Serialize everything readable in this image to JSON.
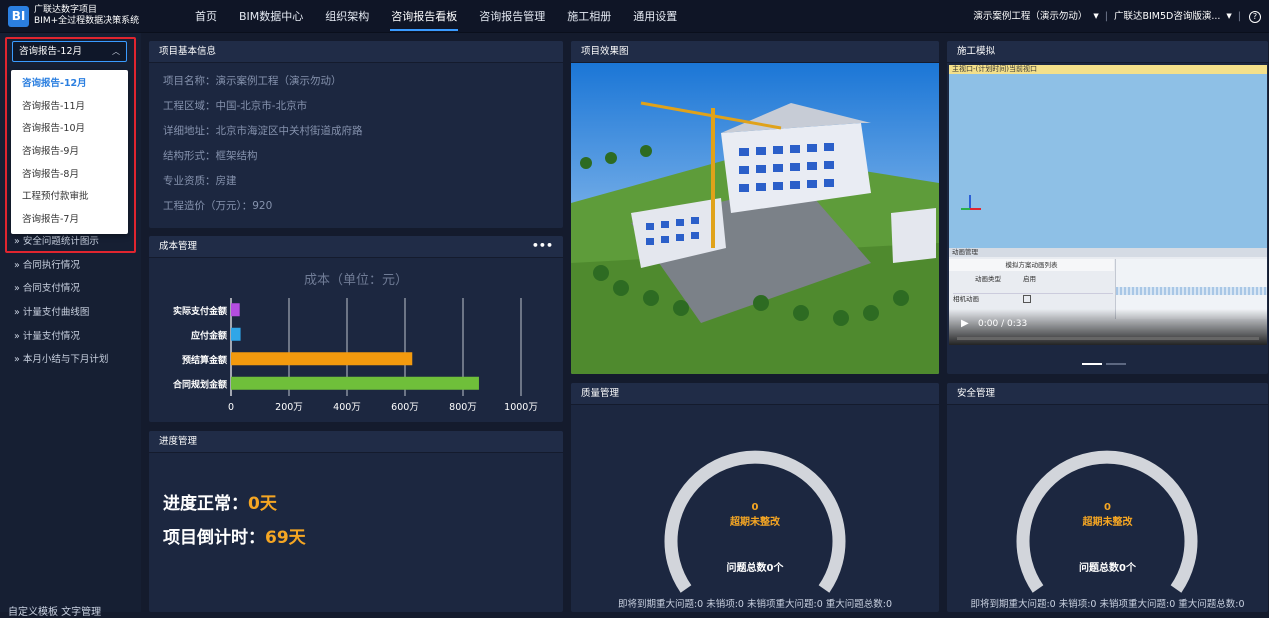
{
  "app": {
    "logo_text": "BI",
    "brand_line1": "广联达数字项目",
    "brand_line2": "BIM+全过程数据决策系统"
  },
  "nav": [
    {
      "label": "首页"
    },
    {
      "label": "BIM数据中心"
    },
    {
      "label": "组织架构"
    },
    {
      "label": "咨询报告看板",
      "active": true
    },
    {
      "label": "咨询报告管理"
    },
    {
      "label": "施工相册"
    },
    {
      "label": "通用设置"
    }
  ],
  "topright": {
    "project": "演示案例工程（演示勿动）",
    "company": "广联达BIM5D咨询版演...",
    "sep": "|",
    "help": "?"
  },
  "sidebar": {
    "select_value": "咨询报告-12月",
    "dropdown": [
      "咨询报告-12月",
      "咨询报告-11月",
      "咨询报告-10月",
      "咨询报告-9月",
      "咨询报告-8月",
      "工程预付款审批",
      "咨询报告-7月"
    ],
    "items": [
      "» 安全问题统计图示",
      "» 合同执行情况",
      "» 合同支付情况",
      "» 计量支付曲线图",
      "» 计量支付情况",
      "» 本月小结与下月计划"
    ],
    "bottom": "自定义模板      文字管理"
  },
  "panels": {
    "info": {
      "title": "项目基本信息",
      "rows": [
        {
          "label": "项目名称：",
          "value": "演示案例工程（演示勿动）"
        },
        {
          "label": "工程区域：",
          "value": "中国-北京市-北京市"
        },
        {
          "label": "详细地址：",
          "value": "北京市海淀区中关村街道成府路"
        },
        {
          "label": "结构形式：",
          "value": "框架结构"
        },
        {
          "label": "专业资质：",
          "value": "房建"
        },
        {
          "label": "工程造价（万元）：",
          "value": "920"
        }
      ]
    },
    "cost": {
      "title": "成本管理",
      "more": "•••"
    },
    "progress": {
      "title": "进度管理",
      "line1_label": "进度正常：",
      "line1_value": "0天",
      "line2_label": "项目倒计时：",
      "line2_value": "69天"
    },
    "render": {
      "title": "项目效果图"
    },
    "sim": {
      "title": "施工模拟",
      "bar_text": "主视口-(计划时间)当前视口",
      "anim_title": "动画管理",
      "list_title": "模拟方案动画列表",
      "col1": "动画类型",
      "col2": "启用",
      "row2": "相机动画",
      "video_time": "0:00 / 0:33",
      "play": "▶"
    },
    "quality": {
      "title": "质量管理",
      "count": "0",
      "count_label": "超期未整改",
      "total": "问题总数0个",
      "footer": "即将到期重大问题:0  未销项:0  未销项重大问题:0  重大问题总数:0"
    },
    "safety": {
      "title": "安全管理",
      "count": "0",
      "count_label": "超期未整改",
      "total": "问题总数0个",
      "footer": "即将到期重大问题:0  未销项:0  未销项重大问题:0  重大问题总数:0"
    }
  },
  "chart_data": {
    "type": "bar",
    "orientation": "horizontal",
    "title": "成本（单位：元）",
    "categories": [
      "实际支付金额",
      "应付金额",
      "预结算金额",
      "合同规划金额"
    ],
    "values": [
      300000,
      330000,
      6250000,
      8550000
    ],
    "colors": [
      "#b44de0",
      "#2fa6e8",
      "#f39a0e",
      "#6fbf3a"
    ],
    "xlim": [
      0,
      10000000
    ],
    "xticks": [
      "0",
      "200万",
      "400万",
      "600万",
      "800万",
      "1000万"
    ],
    "grid": true
  }
}
